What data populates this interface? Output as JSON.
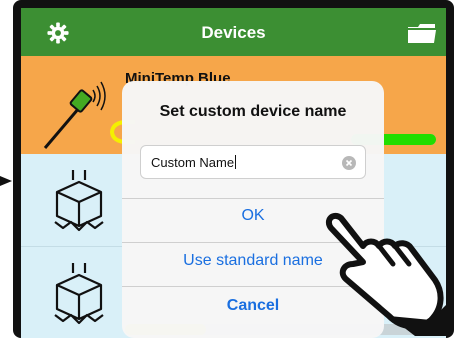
{
  "header": {
    "title": "Devices",
    "left_icon": "gear-icon",
    "right_icon": "folder-icon",
    "color": "#3c8f33"
  },
  "devices": [
    {
      "name": "MiniTemp Blue",
      "icon": "temperature-probe-icon",
      "bar_color": "#22dd00",
      "bar_level": 1.0
    },
    {
      "name": "",
      "icon": "box-sensor-icon",
      "bar_level": 0.0
    },
    {
      "name": "",
      "icon": "box-sensor-icon",
      "bar_color": "#f4f000",
      "bar_level": 0.26
    }
  ],
  "dialog": {
    "title": "Set custom device name",
    "input_value": "Custom Name",
    "ok_label": "OK",
    "standard_label": "Use standard name",
    "cancel_label": "Cancel",
    "link_color": "#1a6fe0"
  },
  "overlay": {
    "pointer_icon": "pointing-hand-icon"
  }
}
